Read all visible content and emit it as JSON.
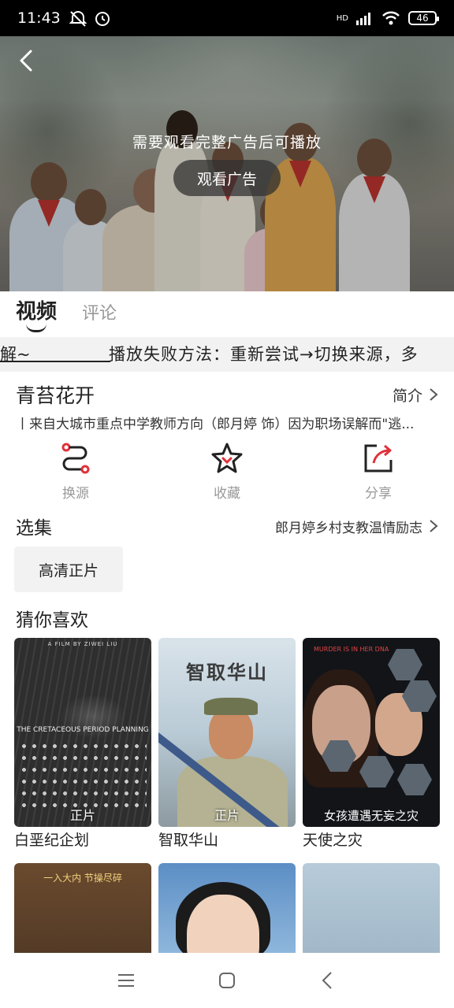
{
  "status_bar": {
    "time": "11:43",
    "network": "HD",
    "battery": "46"
  },
  "player": {
    "ad_notice": "需要观看完整广告后可播放",
    "ad_button": "观看广告"
  },
  "tabs": [
    {
      "label": "视频",
      "active": true
    },
    {
      "label": "评论",
      "active": false
    }
  ],
  "marquee": {
    "part1": "解~",
    "part2": "播放失败方法：重新尝试→切换来源，多"
  },
  "video": {
    "title": "青苔花开",
    "intro_label": "简介",
    "description": "丨来自大城市重点中学教师方向（郎月婷 饰）因为职场误解而\"逃..."
  },
  "actions": [
    {
      "icon": "switch-source-icon",
      "label": "换源"
    },
    {
      "icon": "star-icon",
      "label": "收藏"
    },
    {
      "icon": "share-icon",
      "label": "分享"
    }
  ],
  "episodes": {
    "title": "选集",
    "summary": "郎月婷乡村支教温情励志",
    "chip": "高清正片"
  },
  "recommend": {
    "title": "猜你喜欢",
    "items": [
      {
        "title": "白垩纪企划",
        "badge": "正片",
        "poster_top": "A FILM BY ZIWEI LIU",
        "poster_mid": "THE CRETACEOUS PERIOD PLANNING"
      },
      {
        "title": "智取华山",
        "badge": "正片",
        "poster_top": "智取华山"
      },
      {
        "title": "天使之灾",
        "badge": "",
        "poster_top": "MURDER IS IN HER DNA",
        "poster_caption": "女孩遭遇无妄之灾"
      },
      {
        "title": "",
        "badge": "",
        "poster_top": "一入大内 节操尽碎"
      },
      {
        "title": "",
        "badge": ""
      },
      {
        "title": "",
        "badge": ""
      }
    ]
  },
  "colors": {
    "accent_red": "#e0313a",
    "text_primary": "#222222",
    "text_secondary": "#999999",
    "chip_bg": "#f2f2f2"
  }
}
